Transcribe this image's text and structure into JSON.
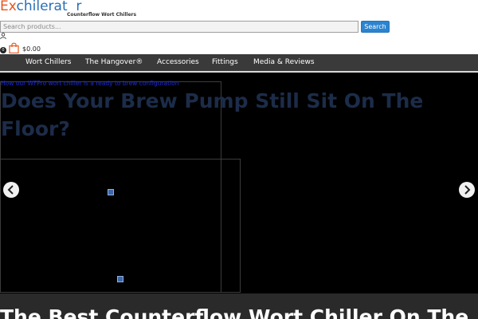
{
  "logo": {
    "brand_prefix": "Ex",
    "brand_rest": "chilerat  r",
    "tagline": "Counterflow Wort Chillers"
  },
  "search": {
    "placeholder": "Search products...",
    "button_label": "Search"
  },
  "cart": {
    "count": "0",
    "total": "$0.00"
  },
  "nav": {
    "items": [
      {
        "label": "Wort Chillers"
      },
      {
        "label": "The Hangover®"
      },
      {
        "label": "Accessories"
      },
      {
        "label": "Fittings"
      },
      {
        "label": "Media & Reviews"
      }
    ]
  },
  "hero": {
    "slide_link": "How our WFPro wort chiller is a ready to brew configuration",
    "slide_title": "Does Your Brew Pump Still Sit On The Floor?",
    "bottom_title": "The Best Counterflow Wort Chiller On The"
  },
  "colors": {
    "brand_orange": "#e8561d",
    "brand_blue": "#2a6fb5",
    "search_button": "#2b84d0",
    "nav_bar": "#3a3a3a",
    "hero_bg": "#000000",
    "slide_title": "#1c2c49"
  },
  "icons": {
    "user": "user-icon",
    "cart": "shopping-bag-icon",
    "prev": "chevron-left-icon",
    "next": "chevron-right-icon",
    "broken_image": "broken-image-icon"
  }
}
